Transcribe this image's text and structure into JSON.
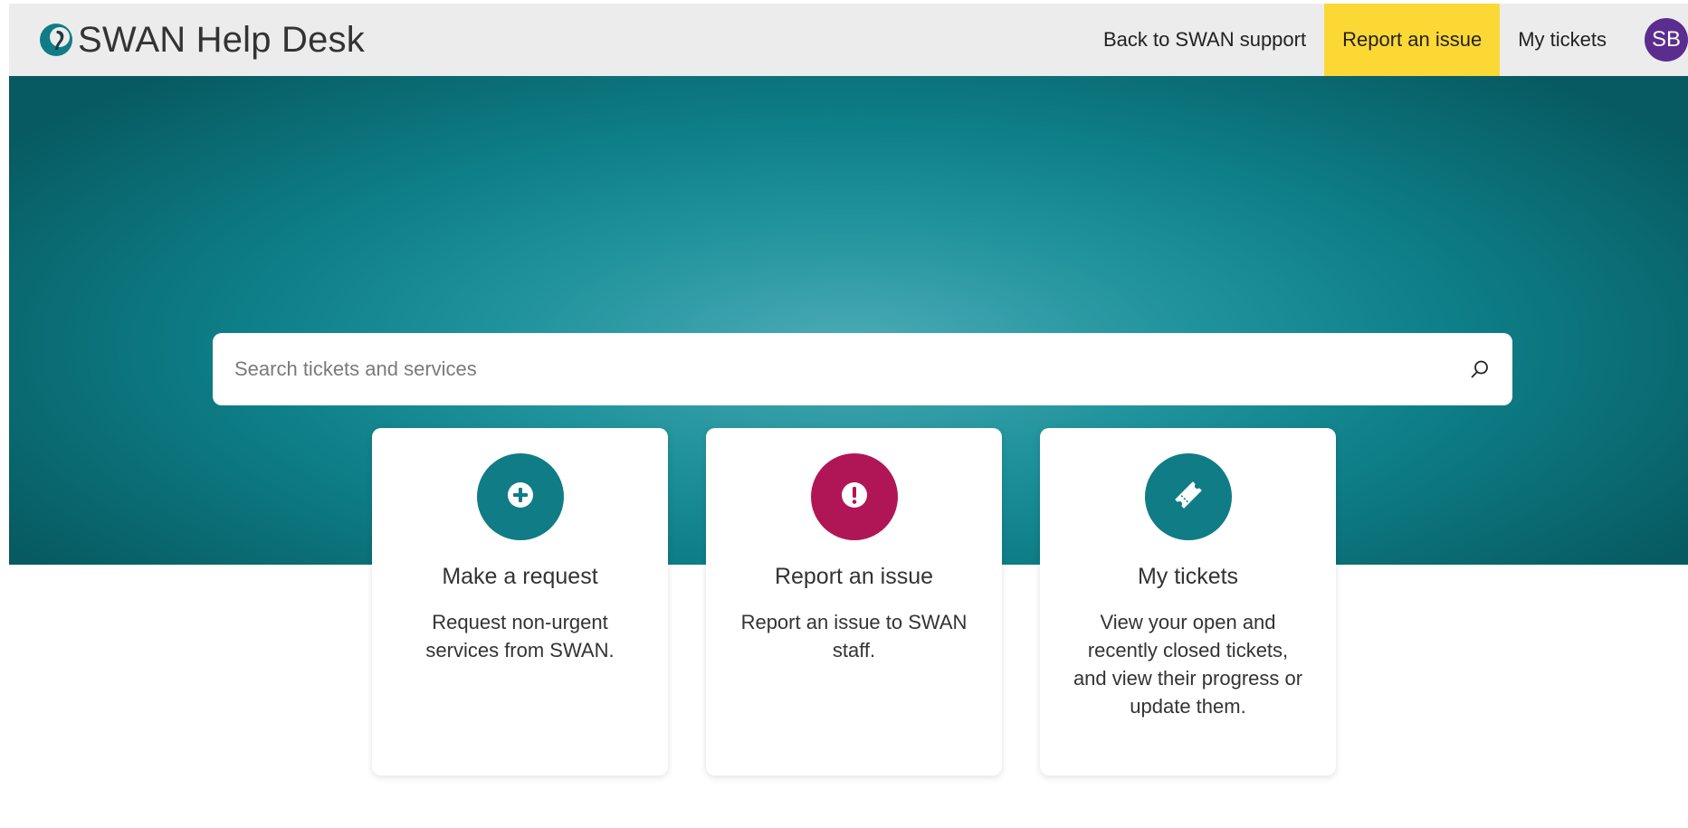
{
  "header": {
    "title": "SWAN Help Desk",
    "nav": {
      "back_label": "Back to SWAN support",
      "report_label": "Report an issue",
      "tickets_label": "My tickets"
    },
    "avatar_initials": "SB"
  },
  "search": {
    "placeholder": "Search tickets and services"
  },
  "cards": [
    {
      "title": "Make a request",
      "description": "Request non-urgent services from SWAN.",
      "icon": "plus-circle-icon",
      "color": "#0f7c86"
    },
    {
      "title": "Report an issue",
      "description": "Report an issue to SWAN staff.",
      "icon": "exclamation-circle-icon",
      "color": "#b01656"
    },
    {
      "title": "My tickets",
      "description": "View your open and recently closed tickets, and view their progress or update them.",
      "icon": "ticket-icon",
      "color": "#0f7c86"
    }
  ],
  "colors": {
    "accent_yellow": "#fcd835",
    "teal": "#0f7c86",
    "magenta": "#b01656",
    "avatar_purple": "#5b2d8e"
  }
}
